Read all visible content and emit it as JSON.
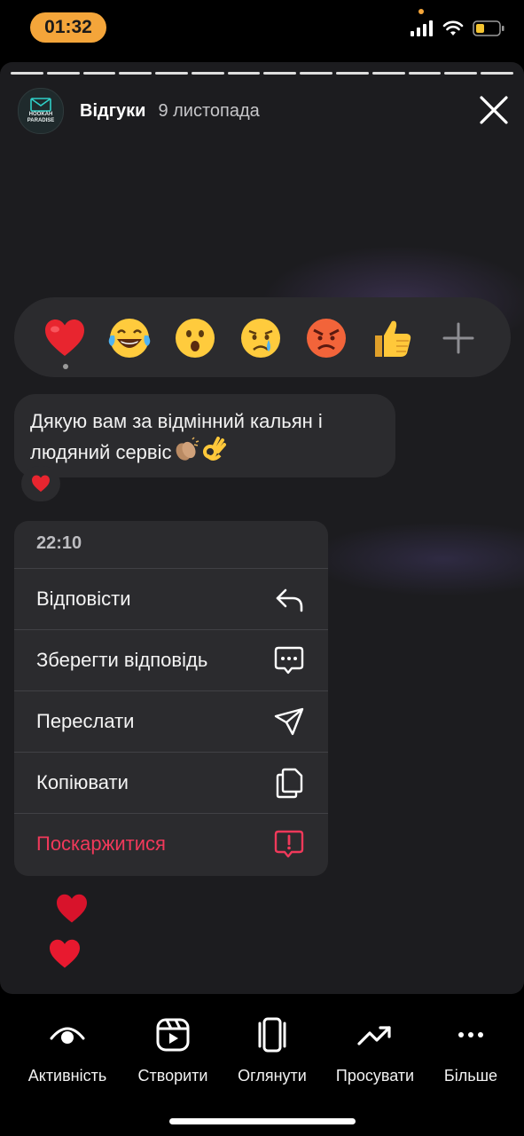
{
  "status_bar": {
    "time": "01:32",
    "icons": [
      "cellular-signal-icon",
      "wifi-icon",
      "battery-low-icon"
    ],
    "accent_color": "#f4a53a"
  },
  "story": {
    "progress_segments": 14,
    "avatar_lines": [
      "HOOKAH",
      "PARADISE"
    ],
    "title": "Відгуки",
    "date": "9 листопада",
    "close_icon": "close-icon"
  },
  "reactions": {
    "items": [
      "red-heart",
      "tears-of-joy",
      "surprised-face",
      "crying-face",
      "angry-face",
      "thumbs-up"
    ],
    "selected": "red-heart",
    "add_icon": "plus-icon"
  },
  "message": {
    "text": "Дякую вам за відмінний кальян і людяний сервіс",
    "trailing_emoji": [
      "clapping-hands",
      "ok-hand"
    ],
    "reaction": "red-heart"
  },
  "context_menu": {
    "time": "22:10",
    "items": [
      {
        "label": "Відповісти",
        "icon": "reply-arrow-icon"
      },
      {
        "label": "Зберегти відповідь",
        "icon": "chat-bubble-icon"
      },
      {
        "label": "Переслати",
        "icon": "send-icon"
      },
      {
        "label": "Копіювати",
        "icon": "copy-icon"
      },
      {
        "label": "Поскаржитися",
        "icon": "report-icon",
        "color": "#f0395a"
      }
    ]
  },
  "toolbar": {
    "items": [
      {
        "label": "Активність",
        "icon": "eye-icon"
      },
      {
        "label": "Створити",
        "icon": "reels-icon"
      },
      {
        "label": "Оглянути",
        "icon": "carousel-icon"
      },
      {
        "label": "Просувати",
        "icon": "trending-up-icon"
      },
      {
        "label": "Більше",
        "icon": "more-icon"
      }
    ]
  }
}
